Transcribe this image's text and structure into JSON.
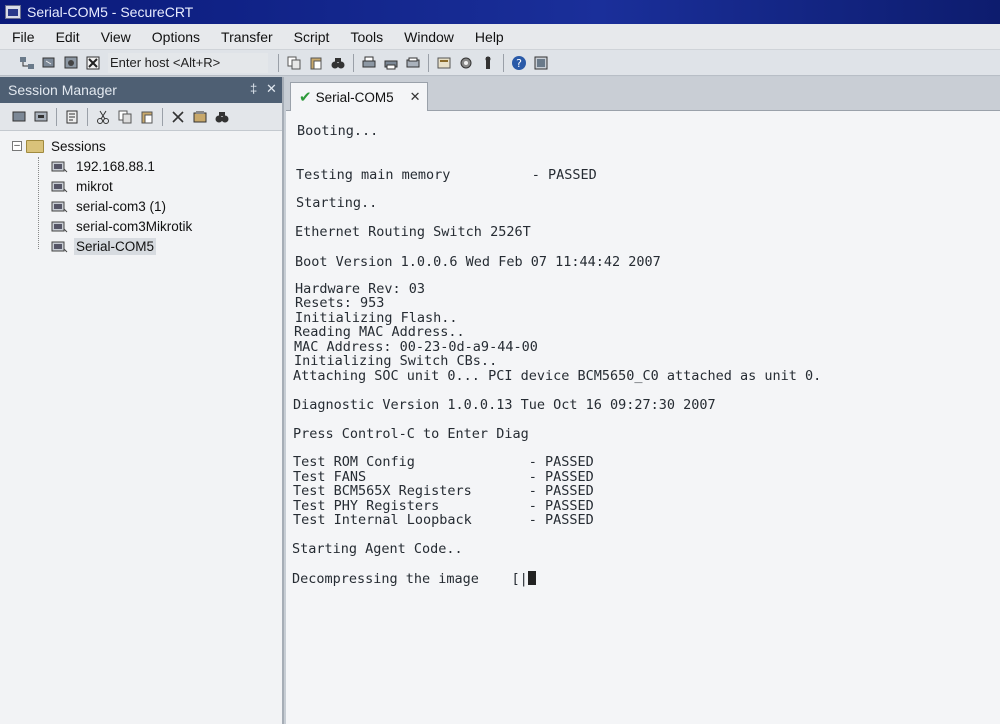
{
  "window": {
    "title": "Serial-COM5 - SecureCRT"
  },
  "menu": [
    "File",
    "Edit",
    "View",
    "Options",
    "Transfer",
    "Script",
    "Tools",
    "Window",
    "Help"
  ],
  "toolbar": {
    "quick_connect_placeholder": "Enter host <Alt+R>"
  },
  "session_manager": {
    "title": "Session Manager",
    "pin_label": "‡",
    "close_label": "✕",
    "root": "Sessions",
    "items": [
      {
        "label": "192.168.88.1"
      },
      {
        "label": "mikrot"
      },
      {
        "label": "serial-com3 (1)"
      },
      {
        "label": "serial-com3Mikrotik"
      },
      {
        "label": "Serial-COM5",
        "selected": true
      }
    ]
  },
  "tabs": [
    {
      "label": "Serial-COM5",
      "status": "connected",
      "close": "✕"
    }
  ],
  "terminal": {
    "lines": [
      "Booting...",
      "Testing main memory          - PASSED",
      "Starting..",
      "Ethernet Routing Switch 2526T",
      "Boot Version 1.0.0.6 Wed Feb 07 11:44:42 2007",
      "Hardware Rev: 03",
      "Resets: 953",
      "Initializing Flash..",
      "Reading MAC Address..",
      "MAC Address: 00-23-0d-a9-44-00",
      "Initializing Switch CBs..",
      "Attaching SOC unit 0... PCI device BCM5650_C0 attached as unit 0.",
      "Diagnostic Version 1.0.0.13 Tue Oct 16 09:27:30 2007",
      "Press Control-C to Enter Diag",
      "Test ROM Config              - PASSED",
      "Test FANS                    - PASSED",
      "Test BCM565X Registers       - PASSED",
      "Test PHY Registers           - PASSED",
      "Test Internal Loopback       - PASSED",
      "Starting Agent Code..",
      "Decompressing the image    [|"
    ]
  }
}
